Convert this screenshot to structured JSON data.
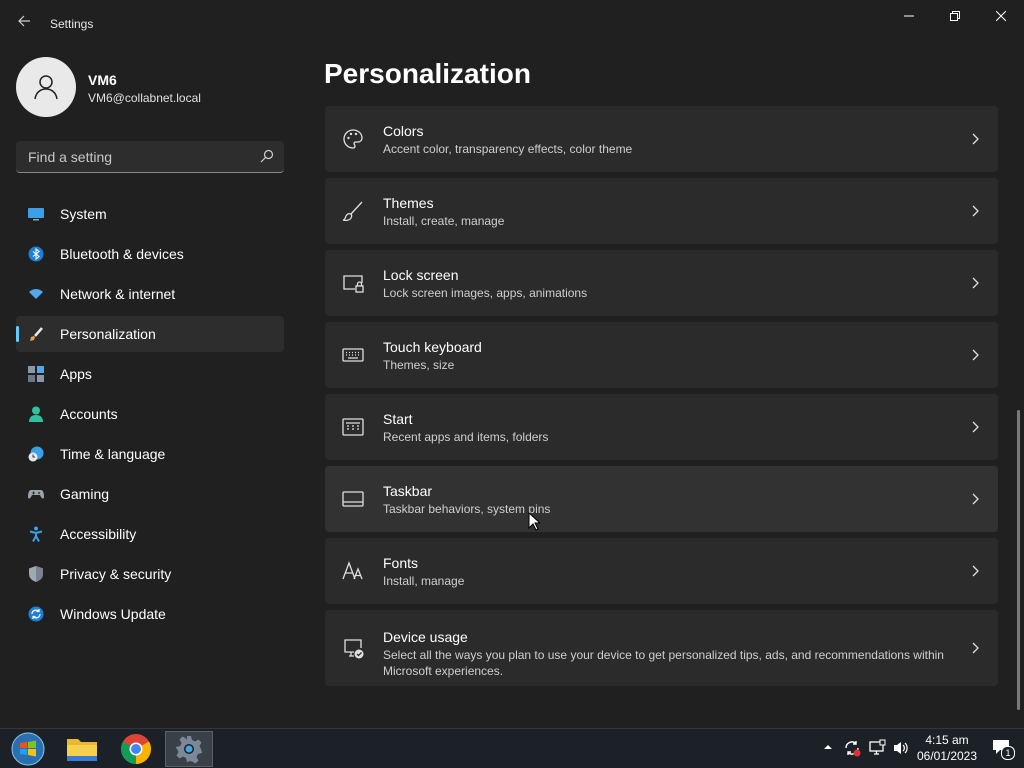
{
  "window": {
    "title": "Settings",
    "back_icon": "back-arrow-icon",
    "minimize_icon": "minimize-icon",
    "maximize_icon": "restore-icon",
    "close_icon": "close-icon"
  },
  "profile": {
    "name": "VM6",
    "email": "VM6@collabnet.local",
    "avatar_icon": "user-avatar-icon"
  },
  "search": {
    "placeholder": "Find a setting",
    "value": "",
    "icon": "search-icon"
  },
  "nav": {
    "selected": "Personalization",
    "accent": "#60cdff",
    "items": [
      {
        "label": "System",
        "icon": "monitor-icon"
      },
      {
        "label": "Bluetooth & devices",
        "icon": "bluetooth-icon"
      },
      {
        "label": "Network & internet",
        "icon": "wifi-icon"
      },
      {
        "label": "Personalization",
        "icon": "paintbrush-icon"
      },
      {
        "label": "Apps",
        "icon": "apps-icon"
      },
      {
        "label": "Accounts",
        "icon": "person-icon"
      },
      {
        "label": "Time & language",
        "icon": "clock-globe-icon"
      },
      {
        "label": "Gaming",
        "icon": "gamepad-icon"
      },
      {
        "label": "Accessibility",
        "icon": "accessibility-icon"
      },
      {
        "label": "Privacy & security",
        "icon": "shield-icon"
      },
      {
        "label": "Windows Update",
        "icon": "update-icon"
      }
    ]
  },
  "main": {
    "title": "Personalization",
    "cards": [
      {
        "title": "Colors",
        "desc": "Accent color, transparency effects, color theme",
        "icon": "palette-icon"
      },
      {
        "title": "Themes",
        "desc": "Install, create, manage",
        "icon": "brush-icon"
      },
      {
        "title": "Lock screen",
        "desc": "Lock screen images, apps, animations",
        "icon": "lock-screen-icon"
      },
      {
        "title": "Touch keyboard",
        "desc": "Themes, size",
        "icon": "keyboard-icon"
      },
      {
        "title": "Start",
        "desc": "Recent apps and items, folders",
        "icon": "start-menu-icon"
      },
      {
        "title": "Taskbar",
        "desc": "Taskbar behaviors, system pins",
        "icon": "taskbar-icon"
      },
      {
        "title": "Fonts",
        "desc": "Install, manage",
        "icon": "fonts-icon"
      },
      {
        "title": "Device usage",
        "desc": "Select all the ways you plan to use your device to get personalized tips, ads, and recommendations within Microsoft experiences.",
        "icon": "device-usage-icon"
      }
    ]
  },
  "taskbar": {
    "pinned": [
      {
        "name": "Start",
        "icon": "windows-start-icon"
      },
      {
        "name": "File Explorer",
        "icon": "folder-icon"
      },
      {
        "name": "Google Chrome",
        "icon": "chrome-icon"
      },
      {
        "name": "Settings",
        "icon": "settings-gear-icon",
        "active": true
      }
    ],
    "tray": {
      "icons": [
        "chevron-up-icon",
        "sync-icon",
        "network-icon",
        "volume-icon"
      ],
      "time": "4:15 am",
      "date": "06/01/2023",
      "notifications": "1"
    }
  }
}
